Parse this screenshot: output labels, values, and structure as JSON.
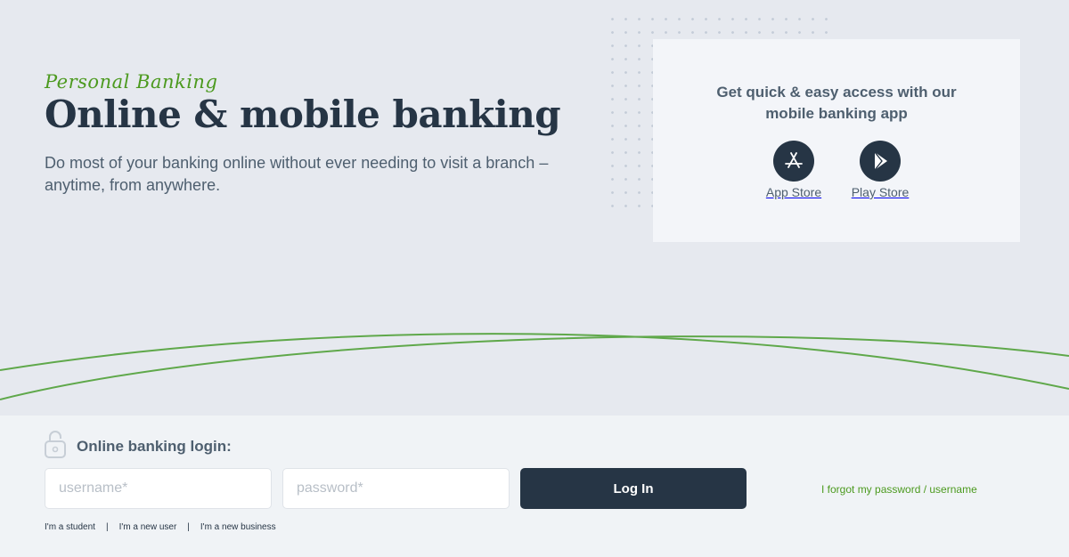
{
  "hero": {
    "eyebrow": "Personal Banking",
    "title": "Online & mobile banking",
    "subtitle": "Do most of your banking online without ever needing to visit a branch – anytime, from anywhere."
  },
  "app_card": {
    "title": "Get quick & easy access with our mobile banking app",
    "stores": [
      {
        "label": "App Store",
        "icon": "app-store-icon"
      },
      {
        "label": "Play Store",
        "icon": "play-store-icon"
      }
    ]
  },
  "login": {
    "title": "Online banking login:",
    "icon": "lock-icon",
    "username_placeholder": "username*",
    "password_placeholder": "password*",
    "button_label": "Log In",
    "forgot_link": "I forgot my password / username",
    "sublinks": [
      "I'm a student",
      "I'm a new user",
      "I'm a new business"
    ],
    "separator": "|"
  },
  "colors": {
    "accent_green": "#4c9a1f",
    "navy": "#263545",
    "background": "#e6e9ef",
    "panel": "#f0f3f6"
  }
}
